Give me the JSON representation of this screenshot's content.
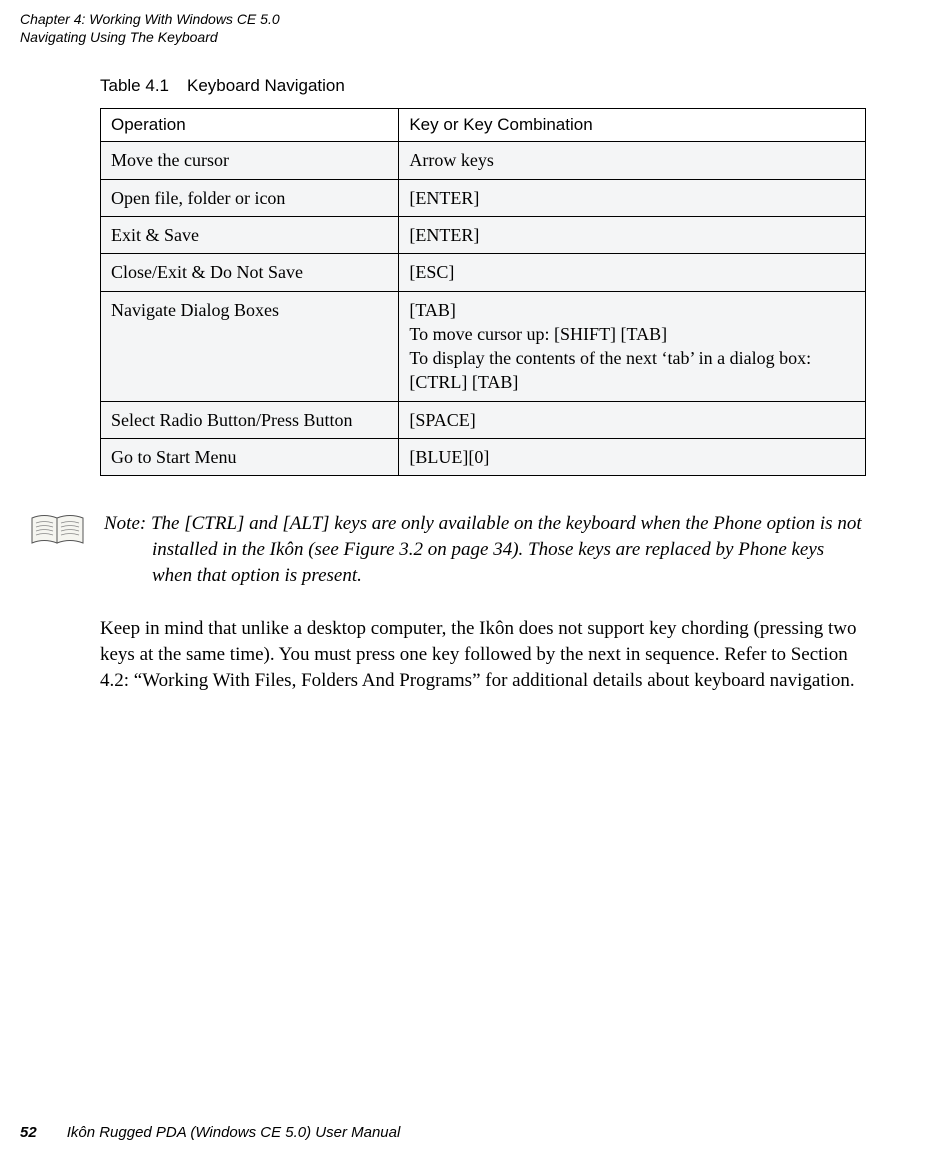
{
  "header": {
    "chapter": "Chapter 4:  Working With Windows CE 5.0",
    "section": "Navigating Using The Keyboard"
  },
  "table": {
    "caption_num": "Table 4.1",
    "caption_title": "Keyboard Navigation",
    "headers": {
      "col1": "Operation",
      "col2": "Key or Key Combination"
    },
    "rows": [
      {
        "op": "Move the cursor",
        "key": "Arrow keys"
      },
      {
        "op": "Open file, folder or icon",
        "key": "[ENTER]"
      },
      {
        "op": "Exit & Save",
        "key": "[ENTER]"
      },
      {
        "op": "Close/Exit & Do Not Save",
        "key": "[ESC]"
      },
      {
        "op": "Navigate Dialog Boxes",
        "key": "[TAB]\nTo move cursor up: [SHIFT] [TAB]\nTo display the contents of the next ‘tab’ in a dialog box: [CTRL] [TAB]"
      },
      {
        "op": "Select Radio Button/Press Button",
        "key": "[SPACE]"
      },
      {
        "op": "Go to Start Menu",
        "key": "[BLUE][0]"
      }
    ]
  },
  "note": {
    "text": "Note: The [CTRL] and [ALT] keys are only available on the keyboard when the Phone option is not installed in the Ikôn (see Figure 3.2 on page 34). Those keys are replaced by Phone keys when that option is present."
  },
  "paragraph": "Keep in mind that unlike a desktop computer, the Ikôn does not support key chording (pressing two keys at the same time). You must press one key followed by the next in sequence. Refer to Section 4.2: “Working With Files, Folders And Programs” for additional details about keyboard navigation.",
  "footer": {
    "page": "52",
    "title": "Ikôn Rugged PDA (Windows CE 5.0) User Manual"
  }
}
